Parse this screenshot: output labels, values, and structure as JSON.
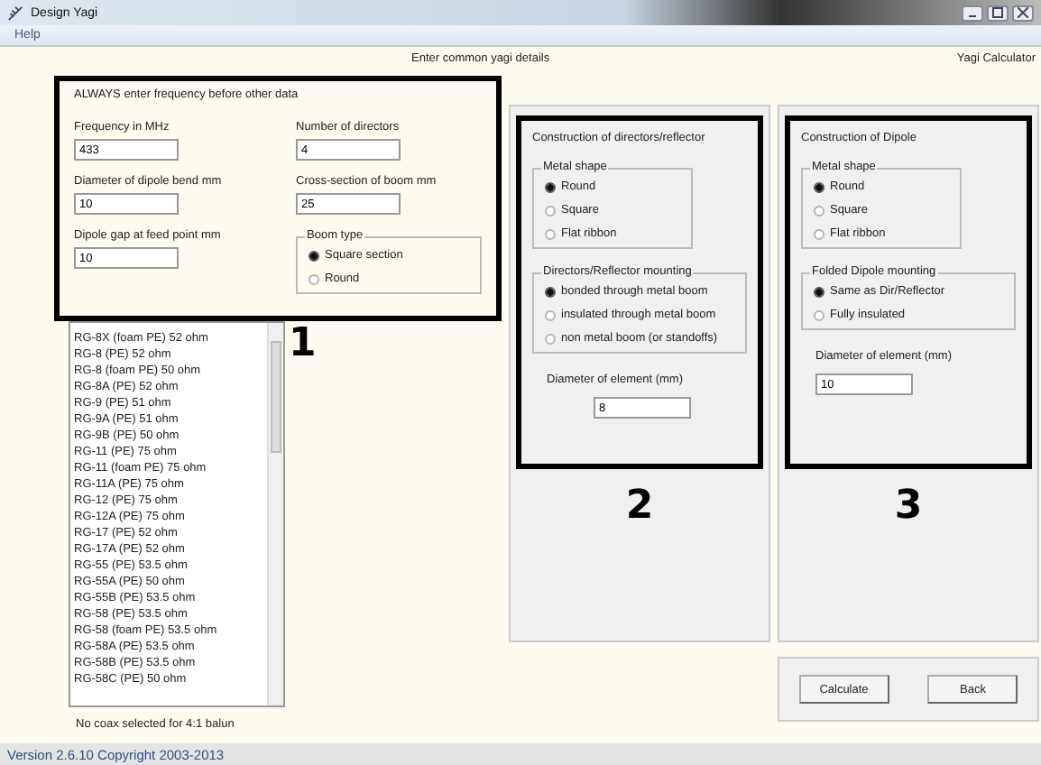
{
  "window": {
    "title": "Design Yagi"
  },
  "menu": [
    {
      "label": "Help"
    }
  ],
  "header": {
    "left": "Enter common yagi details",
    "right": "Yagi Calculator"
  },
  "common": {
    "note": "ALWAYS enter frequency before other data",
    "marker": "1",
    "fields": [
      {
        "label": "Frequency in MHz",
        "value": "433"
      },
      {
        "label": "Number of directors",
        "value": "4"
      },
      {
        "label": "Diameter of dipole bend mm",
        "value": "10"
      },
      {
        "label": "Cross-section of boom mm",
        "value": "25"
      },
      {
        "label": "Dipole gap at feed point mm",
        "value": "10"
      }
    ],
    "boom_type": {
      "title": "Boom type",
      "options": [
        {
          "label": "Square section",
          "selected": true
        },
        {
          "label": "Round",
          "selected": false
        }
      ]
    }
  },
  "coax_list": {
    "items": [
      "RG-8X (foam PE) 52 ohm",
      "RG-8 (PE) 52 ohm",
      "RG-8 (foam PE) 50 ohm",
      "RG-8A (PE) 52 ohm",
      "RG-9 (PE) 51 ohm",
      "RG-9A (PE) 51 ohm",
      "RG-9B (PE) 50 ohm",
      "RG-11 (PE) 75 ohm",
      "RG-11 (foam PE) 75 ohm",
      "RG-11A (PE) 75 ohm",
      "RG-12 (PE) 75 ohm",
      "RG-12A (PE) 75 ohm",
      "RG-17 (PE) 52 ohm",
      "RG-17A (PE) 52 ohm",
      "RG-55 (PE) 53.5 ohm",
      "RG-55A (PE) 50 ohm",
      "RG-55B (PE) 53.5 ohm",
      "RG-58 (PE) 53.5 ohm",
      "RG-58 (foam PE) 53.5 ohm",
      "RG-58A (PE) 53.5 ohm",
      "RG-58B (PE) 53.5 ohm",
      "RG-58C (PE) 50 ohm"
    ],
    "status": "No coax selected for 4:1 balun"
  },
  "panels": [
    {
      "title": "Construction of directors/reflector",
      "marker": "2",
      "groups": [
        {
          "title": "Metal shape",
          "options": [
            {
              "label": "Round",
              "selected": true
            },
            {
              "label": "Square",
              "selected": false
            },
            {
              "label": "Flat ribbon",
              "selected": false
            }
          ]
        },
        {
          "title": "Directors/Reflector mounting",
          "options": [
            {
              "label": "bonded through metal boom",
              "selected": true
            },
            {
              "label": "insulated through metal boom",
              "selected": false
            },
            {
              "label": "non metal boom (or standoffs)",
              "selected": false
            }
          ]
        }
      ],
      "diameter": {
        "label": "Diameter of element (mm)",
        "value": "8"
      }
    },
    {
      "title": "Construction of Dipole",
      "marker": "3",
      "groups": [
        {
          "title": "Metal shape",
          "options": [
            {
              "label": "Round",
              "selected": true
            },
            {
              "label": "Square",
              "selected": false
            },
            {
              "label": "Flat ribbon",
              "selected": false
            }
          ]
        },
        {
          "title": "Folded Dipole mounting",
          "options": [
            {
              "label": "Same as Dir/Reflector",
              "selected": true
            },
            {
              "label": "Fully insulated",
              "selected": false
            }
          ]
        }
      ],
      "diameter": {
        "label": "Diameter of element (mm)",
        "value": "10"
      }
    }
  ],
  "buttons": [
    {
      "label": "Calculate"
    },
    {
      "label": "Back"
    }
  ],
  "status_bar": {
    "version": "Version 2.6.10  Copyright 2003-2013"
  }
}
